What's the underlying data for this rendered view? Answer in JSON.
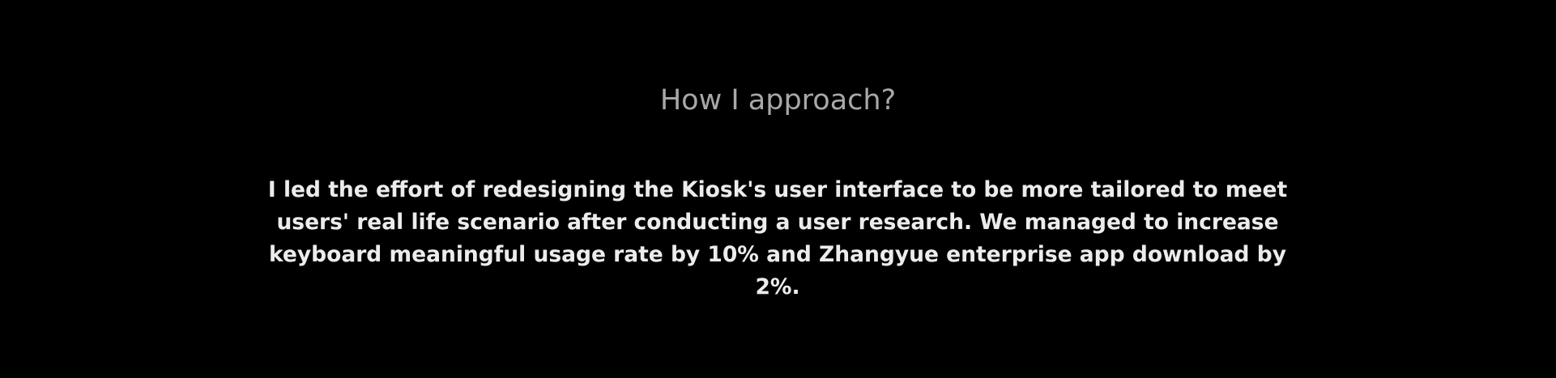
{
  "section": {
    "heading": "How I approach?",
    "paragraph": "I led the effort of redesigning the Kiosk's user interface to be more tailored to meet users' real life scenario after conducting a user research. We managed to increase keyboard meaningful usage rate by 10% and Zhangyue enterprise app download by 2%."
  },
  "colors": {
    "background": "#000000",
    "heading": "#a8a8a8",
    "paragraph": "#ececec"
  }
}
